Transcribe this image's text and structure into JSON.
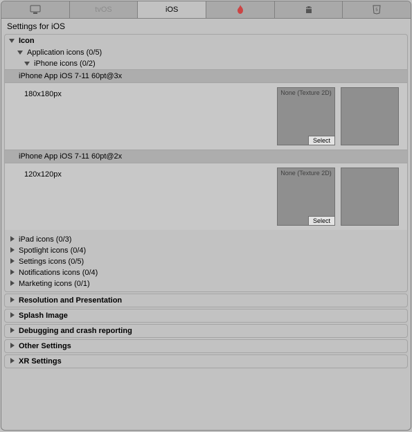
{
  "tabs": {
    "standalone": "",
    "tvos": "tvOS",
    "ios": "iOS",
    "fire": "",
    "android": "",
    "web": ""
  },
  "title": "Settings for iOS",
  "icon": {
    "label": "Icon",
    "app_icons": "Application icons (0/5)",
    "iphone_icons": "iPhone icons (0/2)",
    "slots": [
      {
        "header": "iPhone App iOS 7-11 60pt@3x",
        "size": "180x180px",
        "picker": "None (Texture 2D)",
        "select": "Select"
      },
      {
        "header": "iPhone App iOS 7-11 60pt@2x",
        "size": "120x120px",
        "picker": "None (Texture 2D)",
        "select": "Select"
      }
    ],
    "categories": {
      "ipad": "iPad icons (0/3)",
      "spotlight": "Spotlight icons (0/4)",
      "settings": "Settings icons (0/5)",
      "notifications": "Notifications icons (0/4)",
      "marketing": "Marketing icons (0/1)"
    }
  },
  "sections": {
    "resolution": "Resolution and Presentation",
    "splash": "Splash Image",
    "debug": "Debugging and crash reporting",
    "other": "Other Settings",
    "xr": "XR Settings"
  }
}
